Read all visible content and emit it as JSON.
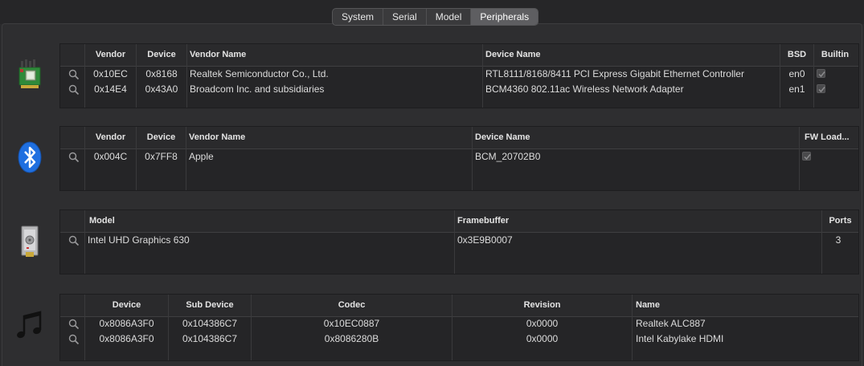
{
  "tabs": [
    "System",
    "Serial",
    "Model",
    "Peripherals"
  ],
  "active_tab": "Peripherals",
  "network": {
    "headers": [
      "Vendor",
      "Device",
      "Vendor Name",
      "Device Name",
      "BSD",
      "Builtin"
    ],
    "rows": [
      {
        "vendor": "0x10EC",
        "device": "0x8168",
        "vendor_name": "Realtek Semiconductor Co., Ltd.",
        "device_name": "RTL8111/8168/8411 PCI Express Gigabit Ethernet Controller",
        "bsd": "en0",
        "builtin": true
      },
      {
        "vendor": "0x14E4",
        "device": "0x43A0",
        "vendor_name": "Broadcom Inc. and subsidiaries",
        "device_name": "BCM4360 802.11ac Wireless Network Adapter",
        "bsd": "en1",
        "builtin": true
      }
    ]
  },
  "bluetooth": {
    "headers": [
      "Vendor",
      "Device",
      "Vendor Name",
      "Device Name",
      "FW Load..."
    ],
    "rows": [
      {
        "vendor": "0x004C",
        "device": "0x7FF8",
        "vendor_name": "Apple",
        "device_name": "BCM_20702B0",
        "fw_load": true
      }
    ]
  },
  "graphics": {
    "headers": [
      "Model",
      "Framebuffer",
      "Ports"
    ],
    "rows": [
      {
        "model": "Intel UHD Graphics 630",
        "framebuffer": "0x3E9B0007",
        "ports": "3"
      }
    ]
  },
  "audio": {
    "headers": [
      "Device",
      "Sub Device",
      "Codec",
      "Revision",
      "Name"
    ],
    "rows": [
      {
        "device": "0x8086A3F0",
        "sub_device": "0x104386C7",
        "codec": "0x10EC0887",
        "revision": "0x0000",
        "name": "Realtek ALC887"
      },
      {
        "device": "0x8086A3F0",
        "sub_device": "0x104386C7",
        "codec": "0x8086280B",
        "revision": "0x0000",
        "name": "Intel Kabylake HDMI"
      }
    ]
  },
  "icons": {
    "network": "network-card-icon",
    "bluetooth": "bluetooth-icon",
    "graphics": "graphics-card-icon",
    "audio": "music-notes-icon",
    "search": "magnifier-icon",
    "check": "checkmark-icon"
  },
  "colors": {
    "active_tab": "#5e5e61",
    "bluetooth_blue": "#1f6fe0",
    "pcb_green": "#2f8a3a"
  }
}
